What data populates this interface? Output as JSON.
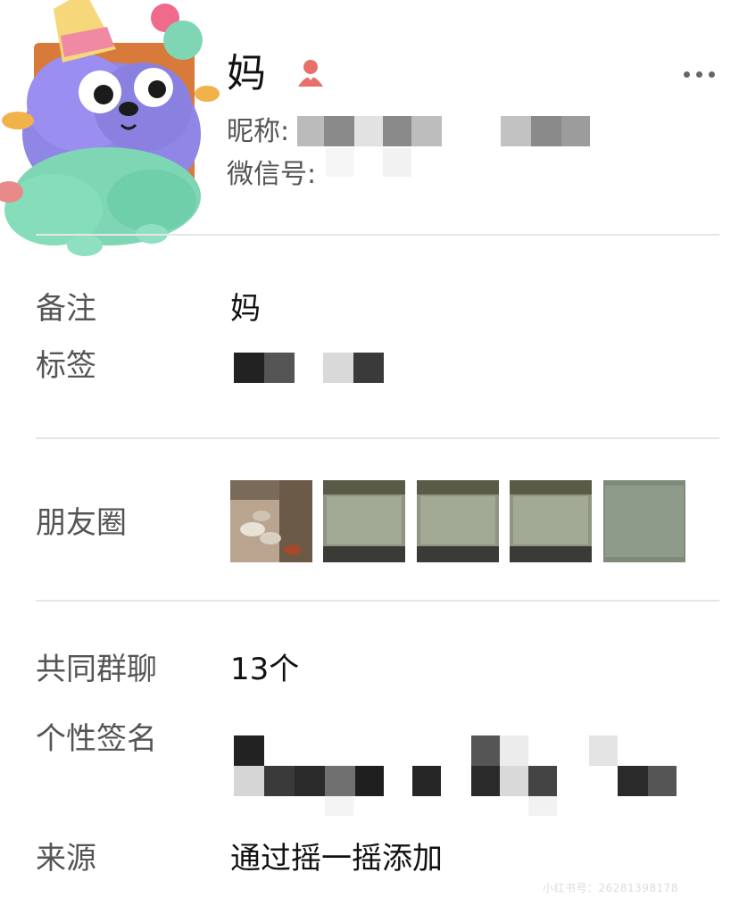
{
  "profile": {
    "name": "妈",
    "nickname_label": "昵称:",
    "wechat_id_label": "微信号:",
    "gender_icon": "female-person-icon",
    "more_icon": "ellipsis-icon"
  },
  "details": {
    "remark_label": "备注",
    "remark_value": "妈",
    "tags_label": "标签",
    "moments_label": "朋友圈",
    "moments_photos": [
      "ducks-photo",
      "granite-slab-photo",
      "granite-slab-photo",
      "granite-slab-photo",
      "granite-slab-photo"
    ],
    "groups_label": "共同群聊",
    "groups_value": "13个",
    "signature_label": "个性签名",
    "source_label": "来源",
    "source_value": "通过摇一摇添加"
  },
  "watermark": "小红书号：26281398178",
  "colors": {
    "gender_icon": "#e8706b",
    "divider": "#e6e6e6",
    "label_text": "#555555",
    "value_text": "#111111"
  }
}
